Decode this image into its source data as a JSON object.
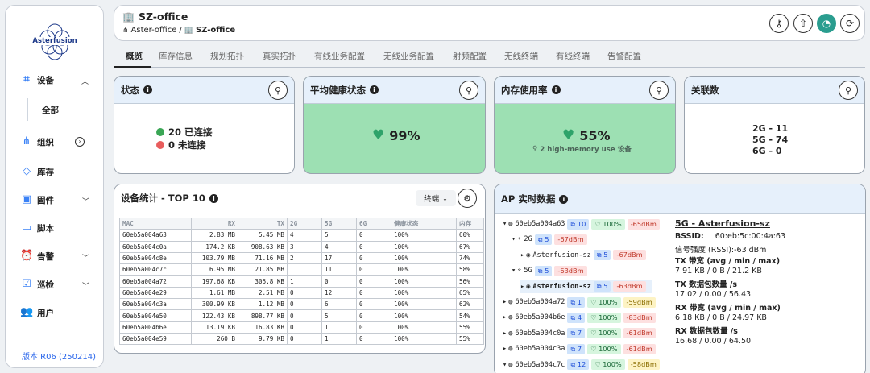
{
  "sidebar": {
    "logo": "Asterfusion",
    "items": [
      {
        "label": "设备",
        "icon": "chip-icon"
      },
      {
        "label": "全部"
      },
      {
        "label": "组织",
        "icon": "org-icon"
      },
      {
        "label": "库存",
        "icon": "tag-icon"
      },
      {
        "label": "固件",
        "icon": "disk-icon"
      },
      {
        "label": "脚本",
        "icon": "terminal-icon"
      },
      {
        "label": "告警",
        "icon": "alarm-icon"
      },
      {
        "label": "巡检",
        "icon": "checklist-icon"
      },
      {
        "label": "用户",
        "icon": "users-icon"
      }
    ],
    "version": "版本 R06 (250214)"
  },
  "header": {
    "title": "SZ-office",
    "crumb_parent": "Aster-office",
    "crumb_sep": "/",
    "crumb_current": "SZ-office"
  },
  "tabs": [
    "概览",
    "库存信息",
    "规划拓扑",
    "真实拓扑",
    "有线业务配置",
    "无线业务配置",
    "射频配置",
    "无线终端",
    "有线终端",
    "告警配置"
  ],
  "cards": {
    "status": {
      "title": "状态",
      "connected": "20 已连接",
      "disconnected": "0 未连接"
    },
    "health": {
      "title": "平均健康状态",
      "value": "99%"
    },
    "memory": {
      "title": "内存使用率",
      "value": "55%",
      "note": "2 high-memory use 设备"
    },
    "assoc": {
      "title": "关联数",
      "lines": [
        "2G - 11",
        "5G - 74",
        "6G - 0"
      ]
    }
  },
  "stats": {
    "title": "设备统计 - TOP 10",
    "filter": "终端",
    "columns": [
      "MAC",
      "RX",
      "TX",
      "2G",
      "5G",
      "6G",
      "健康状态",
      "内存"
    ],
    "rows": [
      [
        "60eb5a004a63",
        "2.83 MB",
        "5.45 MB",
        "4",
        "5",
        "0",
        "100%",
        "60%"
      ],
      [
        "60eb5a004c0a",
        "174.2 KB",
        "908.63 KB",
        "3",
        "4",
        "0",
        "100%",
        "67%"
      ],
      [
        "60eb5a004c8e",
        "103.79 MB",
        "71.16 MB",
        "2",
        "17",
        "0",
        "100%",
        "74%"
      ],
      [
        "60eb5a004c7c",
        "6.95 MB",
        "21.85 MB",
        "1",
        "11",
        "0",
        "100%",
        "58%"
      ],
      [
        "60eb5a004a72",
        "197.68 KB",
        "305.8 KB",
        "1",
        "0",
        "0",
        "100%",
        "56%"
      ],
      [
        "60eb5a004e29",
        "1.61 MB",
        "2.51 MB",
        "0",
        "12",
        "0",
        "100%",
        "65%"
      ],
      [
        "60eb5a004c3a",
        "300.99 KB",
        "1.12 MB",
        "0",
        "6",
        "0",
        "100%",
        "62%"
      ],
      [
        "60eb5a004e50",
        "122.43 KB",
        "898.77 KB",
        "0",
        "5",
        "0",
        "100%",
        "54%"
      ],
      [
        "60eb5a004b6e",
        "13.19 KB",
        "16.83 KB",
        "0",
        "1",
        "0",
        "100%",
        "55%"
      ],
      [
        "60eb5a004e59",
        "260 B",
        "9.79 KB",
        "0",
        "1",
        "0",
        "100%",
        "55%"
      ]
    ]
  },
  "ap": {
    "title": "AP 实时数据",
    "tree": [
      {
        "caret": "▾",
        "icon": "globe-icon",
        "label": "60eb5a004a63",
        "chips": [
          [
            "10",
            "blue"
          ],
          [
            "100%",
            "green"
          ],
          [
            "-65dBm",
            "red"
          ]
        ],
        "indent": 0
      },
      {
        "caret": "▾",
        "icon": "wifi-icon",
        "label": "2G",
        "chips": [
          [
            "5",
            "blue"
          ],
          [
            "-67dBm",
            "red"
          ]
        ],
        "indent": 1
      },
      {
        "caret": "▸",
        "icon": "antenna-icon",
        "label": "Asterfusion-sz",
        "chips": [
          [
            "5",
            "blue"
          ],
          [
            "-67dBm",
            "red"
          ]
        ],
        "indent": 2
      },
      {
        "caret": "▾",
        "icon": "wifi-icon",
        "label": "5G",
        "chips": [
          [
            "5",
            "blue"
          ],
          [
            "-63dBm",
            "red"
          ]
        ],
        "indent": 1
      },
      {
        "caret": "▸",
        "icon": "antenna-icon",
        "label": "Asterfusion-sz",
        "chips": [
          [
            "5",
            "blue"
          ],
          [
            "-63dBm",
            "red"
          ]
        ],
        "indent": 2,
        "selected": true
      },
      {
        "caret": "▸",
        "icon": "globe-icon",
        "label": "60eb5a004a72",
        "chips": [
          [
            "1",
            "blue"
          ],
          [
            "100%",
            "green"
          ],
          [
            "-59dBm",
            "yel"
          ]
        ],
        "indent": 0
      },
      {
        "caret": "▸",
        "icon": "globe-icon",
        "label": "60eb5a004b6e",
        "chips": [
          [
            "4",
            "blue"
          ],
          [
            "100%",
            "green"
          ],
          [
            "-83dBm",
            "red"
          ]
        ],
        "indent": 0
      },
      {
        "caret": "▸",
        "icon": "globe-icon",
        "label": "60eb5a004c0a",
        "chips": [
          [
            "7",
            "blue"
          ],
          [
            "100%",
            "green"
          ],
          [
            "-61dBm",
            "red"
          ]
        ],
        "indent": 0
      },
      {
        "caret": "▸",
        "icon": "globe-icon",
        "label": "60eb5a004c3a",
        "chips": [
          [
            "7",
            "blue"
          ],
          [
            "100%",
            "green"
          ],
          [
            "-61dBm",
            "red"
          ]
        ],
        "indent": 0
      },
      {
        "caret": "▾",
        "icon": "globe-icon",
        "label": "60eb5a004c7c",
        "chips": [
          [
            "12",
            "blue"
          ],
          [
            "100%",
            "green"
          ],
          [
            "-58dBm",
            "yel"
          ]
        ],
        "indent": 0
      }
    ],
    "detail": {
      "title": "5G - Asterfusion-sz",
      "bssid_label": "BSSID:",
      "bssid": "60:eb:5c:00:4a:63",
      "rssi": "信号强度 (RSSI):-63 dBm",
      "tx_label": "TX 带宽 (avg / min / max)",
      "tx": "7.91 KB / 0 B / 21.2 KB",
      "txp_label": "TX 数据包数量 /s",
      "txp": "17.02 / 0.00 / 56.43",
      "rx_label": "RX 带宽 (avg / min / max)",
      "rx": "6.18 KB / 0 B / 24.97 KB",
      "rxp_label": "RX 数据包数量 /s",
      "rxp": "16.68 / 0.00 / 64.50"
    }
  }
}
